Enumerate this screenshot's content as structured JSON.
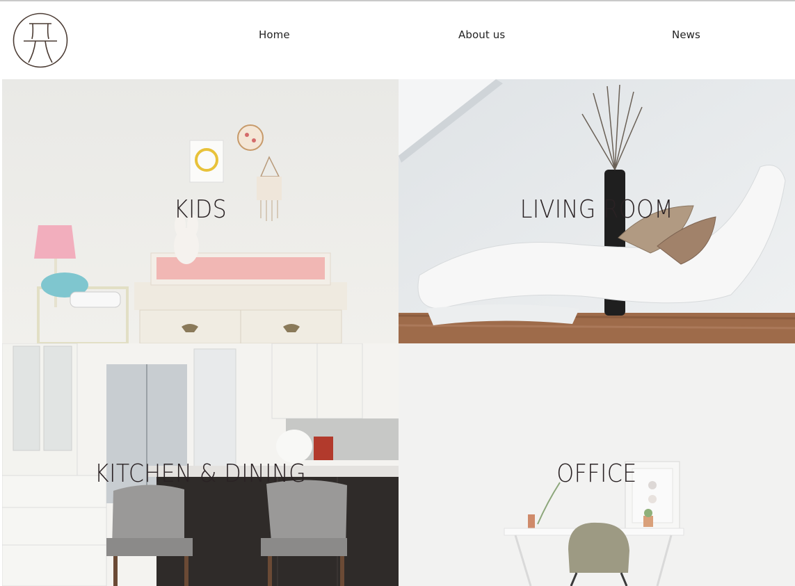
{
  "nav": {
    "logo_icon": "chair-logo-icon",
    "items": [
      {
        "label": "Home"
      },
      {
        "label": "About us"
      },
      {
        "label": "News"
      }
    ]
  },
  "tiles": [
    {
      "label": "KIDS",
      "icon": "kids-room-photo"
    },
    {
      "label": "LIVING ROOM",
      "icon": "living-room-photo"
    },
    {
      "label": "KITCHEN & DINING",
      "icon": "kitchen-photo"
    },
    {
      "label": "OFFICE",
      "icon": "office-photo"
    }
  ],
  "colors": {
    "title_text": "#2a2224",
    "logo_stroke": "#4a3a32",
    "background": "#ffffff"
  }
}
